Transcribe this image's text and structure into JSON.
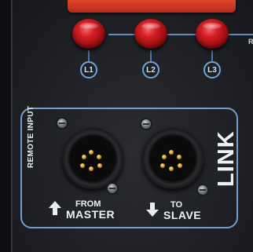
{
  "indicators": [
    {
      "label": "L1",
      "color": "#d41f24"
    },
    {
      "label": "L2",
      "color": "#d41f24"
    },
    {
      "label": "L3",
      "color": "#d41f24"
    }
  ],
  "edge_letter": "R",
  "link_section": {
    "title": "LINK",
    "remote_input_label": "REMOTE INPUT",
    "from": {
      "line1": "FROM",
      "line2": "MASTER",
      "arrow": "up-arrow-icon"
    },
    "to": {
      "line1": "TO",
      "line2": "SLAVE",
      "arrow": "down-arrow-icon"
    }
  },
  "colors": {
    "outline_blue": "#6f9fd0",
    "led_red": "#d41f24",
    "bar_orange": "#d9391f",
    "panel": "#202226"
  }
}
